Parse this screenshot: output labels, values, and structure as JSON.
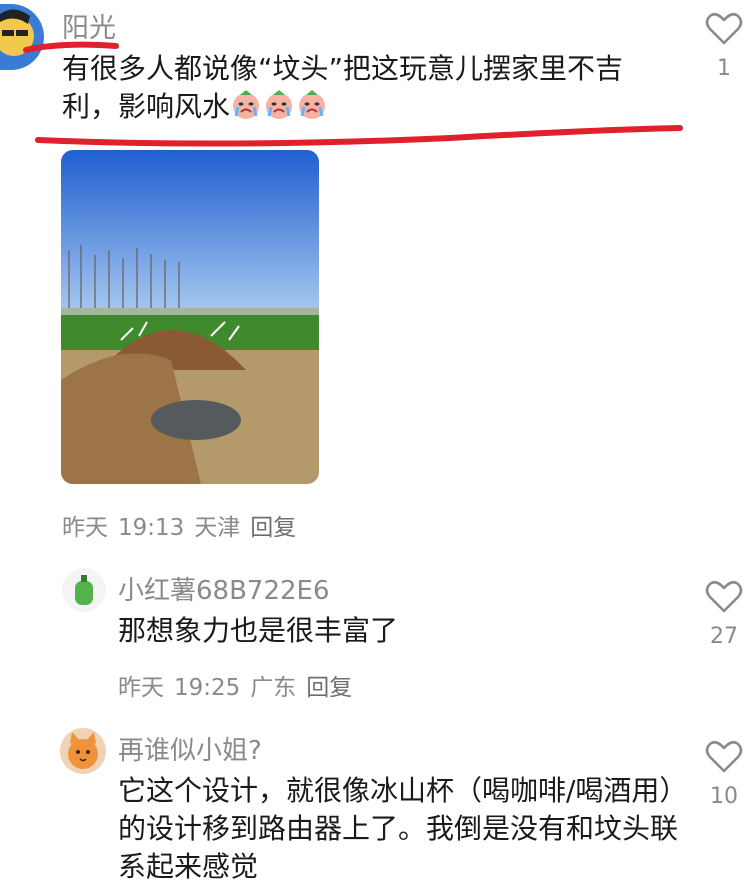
{
  "comments": [
    {
      "username": "阳光",
      "text": "有很多人都说像“坟头”把这玩意儿摆家里不吉利，影响风水",
      "emoji": "crying-face",
      "emoji_count": 3,
      "date": "昨天",
      "time": "19:13",
      "location": "天津",
      "reply_label": "回复",
      "likes": "1"
    },
    {
      "username": "小红薯68B722E6",
      "text": "那想象力也是很丰富了",
      "date": "昨天",
      "time": "19:25",
      "location": "广东",
      "reply_label": "回复",
      "likes": "27"
    },
    {
      "username": "再谁似小姐?",
      "text": "它这个设计，就很像冰山杯（喝咖啡/喝酒用）的设计移到路由器上了。我倒是没有和坟头联系起来感觉",
      "likes": "10"
    }
  ],
  "colors": {
    "annotation": "#e0202a",
    "meta_text": "#8a8a8a",
    "body_text": "#1a1a1a"
  }
}
